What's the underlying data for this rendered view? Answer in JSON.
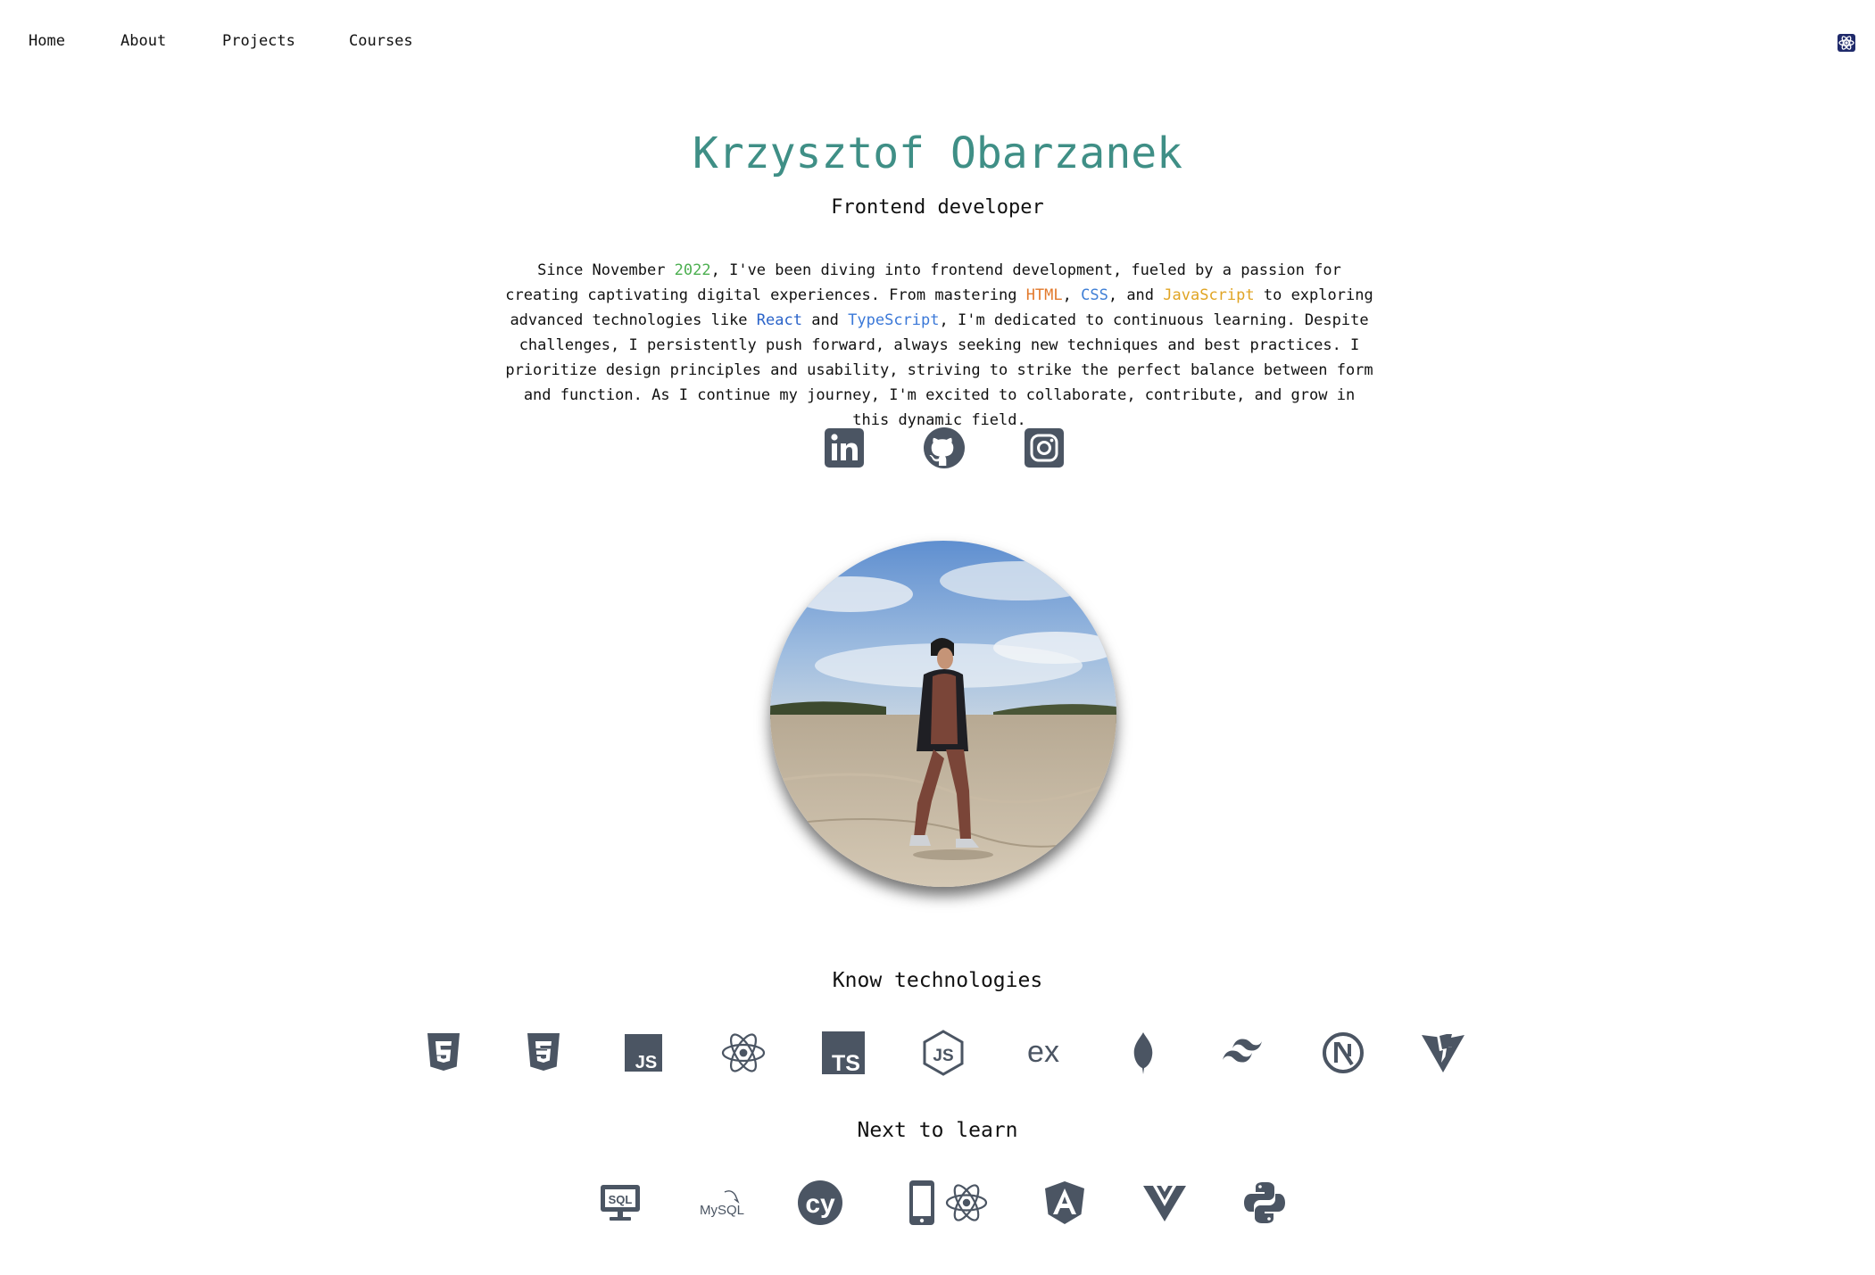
{
  "nav": {
    "items": [
      {
        "label": "Home"
      },
      {
        "label": "About"
      },
      {
        "label": "Projects"
      },
      {
        "label": "Courses"
      }
    ],
    "theme_toggle_icon": "atom-icon"
  },
  "hero": {
    "name": "Krzysztof Obarzanek",
    "role": "Frontend developer",
    "bio": {
      "p1": "Since November ",
      "year": "2022",
      "p2": ", I've been diving into frontend development, fueled by a passion for creating captivating digital experiences. From mastering ",
      "html": "HTML",
      "p3": ", ",
      "css": "CSS",
      "p4": ", and ",
      "js": "JavaScript",
      "p5": " to exploring advanced technologies like ",
      "react": "React",
      "p6": " and ",
      "ts": "TypeScript",
      "p7": ", I'm dedicated to continuous learning. Despite challenges, I persistently push forward, always seeking new techniques and best practices. I prioritize design principles and usability, striving to strike the perfect balance between form and function. As I continue my journey, I'm excited to collaborate, contribute, and grow in this dynamic field."
    },
    "social_icons": [
      "linkedin-icon",
      "github-icon",
      "instagram-icon"
    ]
  },
  "known": {
    "title": "Know technologies",
    "icons": [
      "html5-icon",
      "css3-icon",
      "javascript-icon",
      "react-icon",
      "typescript-icon",
      "nodejs-icon",
      "express-icon",
      "mongodb-icon",
      "tailwind-icon",
      "nextjs-icon",
      "vite-icon"
    ],
    "ts_label": "TS",
    "js_label": "JS",
    "ex_label": "ex"
  },
  "next": {
    "title": "Next to learn",
    "icons": [
      "sql-icon",
      "mysql-icon",
      "cypress-icon",
      "react-native-icon",
      "angular-icon",
      "vue-icon",
      "python-icon"
    ],
    "sql_label": "SQL",
    "mysql_label": "MySQL",
    "cy_label": "cy"
  },
  "colors": {
    "accent": "#3f8f86",
    "icon_gray": "#4b5563",
    "year": "#4caf50",
    "html": "#e2792b",
    "css": "#3f7fd6",
    "javascript": "#e0a423",
    "react": "#2a63c9",
    "typescript": "#3a78d8"
  }
}
